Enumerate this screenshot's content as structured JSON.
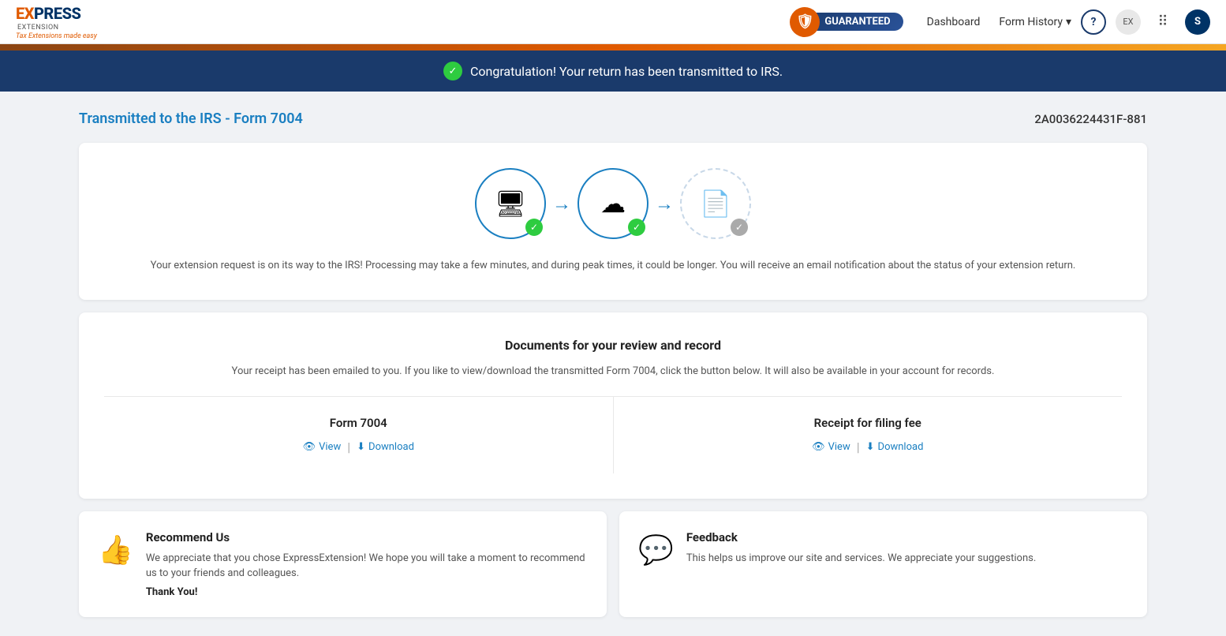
{
  "header": {
    "logo": {
      "express_part": "EXPRESS",
      "extension_part": "EXTENSION",
      "tagline": "Tax Extensions made easy"
    },
    "badge_label": "GUARANTEED",
    "nav": {
      "dashboard_label": "Dashboard",
      "form_history_label": "Form History",
      "form_history_dropdown": "▾"
    },
    "icons": {
      "help": "?",
      "toggle": "EX",
      "grid": "⋮⋮⋮",
      "avatar": "S"
    }
  },
  "success_banner": {
    "text": "Congratulation! Your return has been transmitted to IRS."
  },
  "page": {
    "title": "Transmitted to the IRS - Form 7004",
    "reference_id": "2A0036224431F-881"
  },
  "transmission_card": {
    "description": "Your extension request is on its way to the IRS! Processing may take a few minutes, and during peak times, it could be longer. You will receive an email notification about the status of your extension return."
  },
  "documents_card": {
    "title": "Documents for your review and record",
    "description": "Your receipt has been emailed to you. If you like to view/download the transmitted Form 7004, click the button below. It will also be available in your account for records.",
    "form7004": {
      "name": "Form 7004",
      "view_label": "View",
      "download_label": "Download"
    },
    "receipt": {
      "name": "Receipt for filing fee",
      "view_label": "View",
      "download_label": "Download"
    }
  },
  "recommend_card": {
    "title": "Recommend Us",
    "text": "We appreciate that you chose ExpressExtension! We hope you will take a moment to recommend us to your friends and colleagues.",
    "emphasis": "Thank You!"
  },
  "feedback_card": {
    "title": "Feedback",
    "text": "This helps us improve our site and services. We appreciate your suggestions."
  }
}
